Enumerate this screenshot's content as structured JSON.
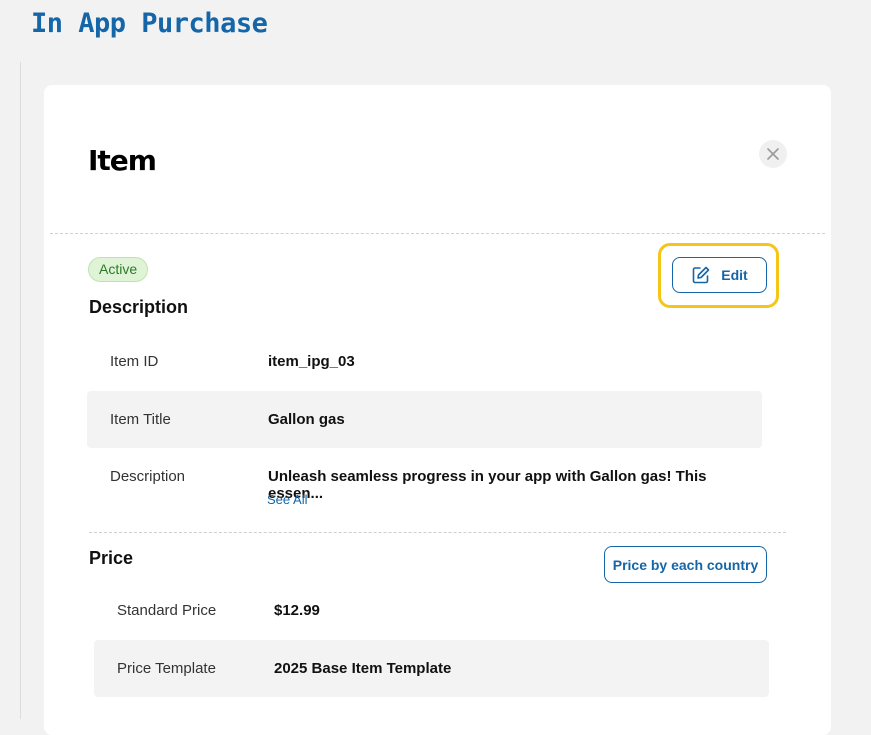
{
  "header": {
    "title": "In App Purchase"
  },
  "card": {
    "title": "Item",
    "status": "Active",
    "edit_label": "Edit",
    "description_section": {
      "heading": "Description",
      "rows": [
        {
          "label": "Item ID",
          "value": "item_ipg_03"
        },
        {
          "label": "Item Title",
          "value": "Gallon gas"
        },
        {
          "label": "Description",
          "value": "Unleash seamless progress in your app with Gallon gas! This essen..."
        }
      ],
      "see_all": "See All"
    },
    "price_section": {
      "heading": "Price",
      "button_label": "Price by each country",
      "rows": [
        {
          "label": "Standard Price",
          "value": "$12.99"
        },
        {
          "label": "Price Template",
          "value": "2025 Base Item Template"
        }
      ]
    }
  },
  "colors": {
    "accent": "#1466a8",
    "highlight": "#f5c518",
    "active_badge_bg": "#dff3d6"
  }
}
